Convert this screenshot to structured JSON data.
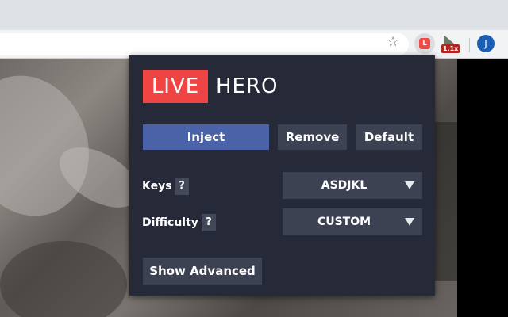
{
  "browser": {
    "extension_live_letter": "L",
    "speed_badge": "1.1x",
    "profile_initial": "J"
  },
  "popup": {
    "logo": {
      "live": "LIVE",
      "hero": "HERO"
    },
    "buttons": {
      "inject": "Inject",
      "remove": "Remove",
      "default": "Default"
    },
    "keys": {
      "label": "Keys",
      "help": "?",
      "value": "ASDJKL"
    },
    "difficulty": {
      "label": "Difficulty",
      "help": "?",
      "value": "CUSTOM"
    },
    "show_advanced": "Show Advanced"
  },
  "colors": {
    "logo_red": "#ef4444",
    "inject_blue": "#4a63a8",
    "popup_bg": "#262a38",
    "control_bg": "#3d4253"
  },
  "icons": [
    "star-icon",
    "live-hero-extension-icon",
    "speed-extension-icon",
    "profile-avatar",
    "dropdown-arrow-icon",
    "help-icon"
  ]
}
